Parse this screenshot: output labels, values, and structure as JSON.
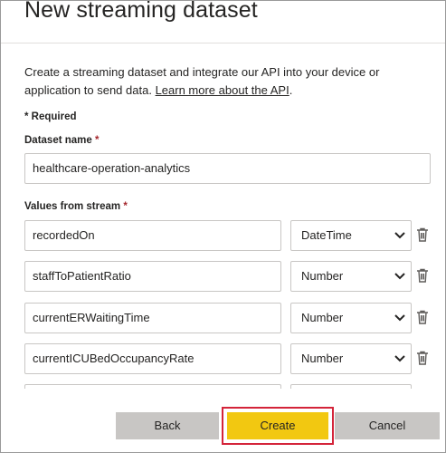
{
  "dialog": {
    "title": "New streaming dataset",
    "description": "Create a streaming dataset and integrate our API into your device or application to send data.",
    "learn_more_link": "Learn more about the API",
    "description_end": ".",
    "required_note": "* Required",
    "required_star": "*"
  },
  "dataset_name": {
    "label": "Dataset name",
    "value": "healthcare-operation-analytics"
  },
  "values_from_stream": {
    "label": "Values from stream",
    "rows": [
      {
        "name": "recordedOn",
        "type": "DateTime"
      },
      {
        "name": "staffToPatientRatio",
        "type": "Number"
      },
      {
        "name": "currentERWaitingTime",
        "type": "Number"
      },
      {
        "name": "currentICUBedOccupancyRate",
        "type": "Number"
      },
      {
        "name": "",
        "type": ""
      }
    ]
  },
  "footer": {
    "back_label": "Back",
    "create_label": "Create",
    "cancel_label": "Cancel"
  },
  "colors": {
    "accent_create": "#f2c811",
    "highlight_border": "#d4243a",
    "required_star": "#a4262c"
  },
  "icons": {
    "row_delete": "trash-icon",
    "select_arrow": "chevron-down-icon"
  }
}
